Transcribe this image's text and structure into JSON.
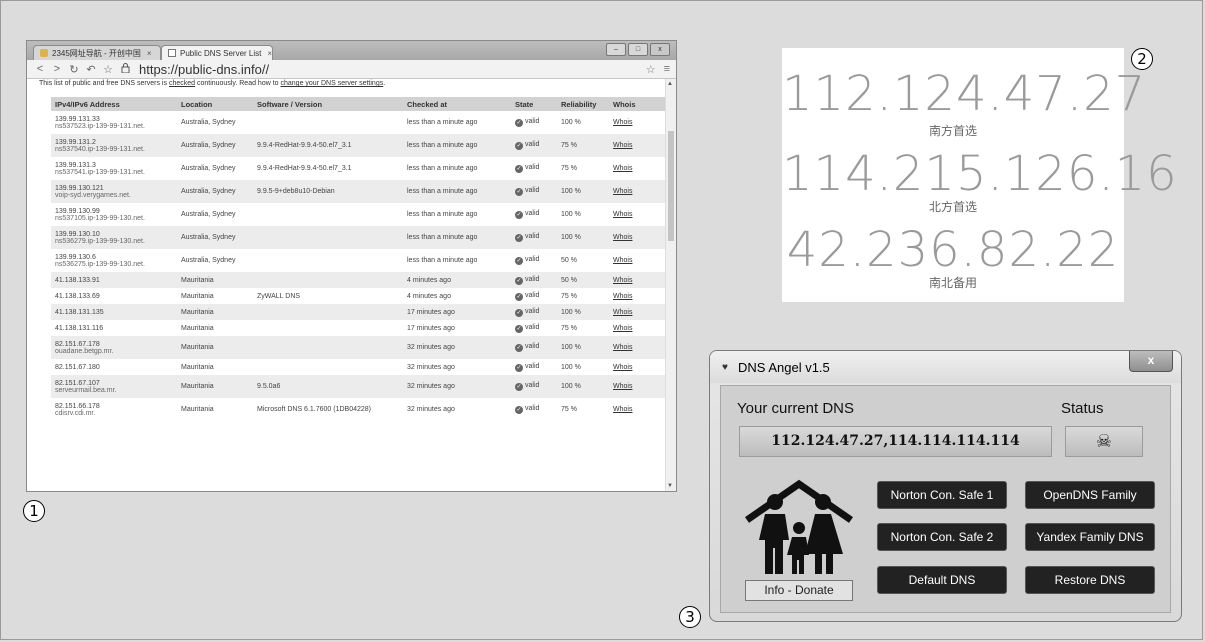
{
  "labels": {
    "one": "1",
    "two": "2",
    "three": "3"
  },
  "browser": {
    "tabs": [
      {
        "label": "2345网址导航 - 开创中国",
        "close": "×"
      },
      {
        "label": "Public DNS Server List",
        "close": "×"
      }
    ],
    "window_buttons": {
      "minimize": "–",
      "maximize": "□",
      "close": "x"
    },
    "nav": {
      "back": "<",
      "forward": ">",
      "reload": "↻",
      "undo": "↶",
      "bookmark": "☆"
    },
    "url": "https://public-dns.info//",
    "addr_right": {
      "star": "☆",
      "menu": "≡"
    },
    "intro": {
      "before": "This list of public and free DNS servers is ",
      "checked": "checked",
      "middle": " continuously. Read how to ",
      "link": "change your DNS server settings",
      "after": "."
    },
    "table": {
      "headers": [
        "IPv4/IPv6 Address",
        "Location",
        "Software / Version",
        "Checked at",
        "State",
        "Reliability",
        "Whois"
      ],
      "rows": [
        {
          "ip": "139.99.131.33",
          "host": "ns537523.ip-139-99-131.net.",
          "location": "Australia, Sydney",
          "software": "",
          "checked": "less than a minute ago",
          "state": "valid",
          "reliability": "100 %",
          "whois": "Whois"
        },
        {
          "ip": "139.99.131.2",
          "host": "ns537540.ip-139-99-131.net.",
          "location": "Australia, Sydney",
          "software": "9.9.4-RedHat-9.9.4-50.el7_3.1",
          "checked": "less than a minute ago",
          "state": "valid",
          "reliability": "75 %",
          "whois": "Whois"
        },
        {
          "ip": "139.99.131.3",
          "host": "ns537541.ip-139-99-131.net.",
          "location": "Australia, Sydney",
          "software": "9.9.4-RedHat-9.9.4-50.el7_3.1",
          "checked": "less than a minute ago",
          "state": "valid",
          "reliability": "75 %",
          "whois": "Whois"
        },
        {
          "ip": "139.99.130.121",
          "host": "voip-syd.verygames.net.",
          "location": "Australia, Sydney",
          "software": "9.9.5-9+deb8u10-Debian",
          "checked": "less than a minute ago",
          "state": "valid",
          "reliability": "100 %",
          "whois": "Whois"
        },
        {
          "ip": "139.99.130.99",
          "host": "ns537105.ip-139-99-130.net.",
          "location": "Australia, Sydney",
          "software": "",
          "checked": "less than a minute ago",
          "state": "valid",
          "reliability": "100 %",
          "whois": "Whois"
        },
        {
          "ip": "139.99.130.10",
          "host": "ns536279.ip-139-99-130.net.",
          "location": "Australia, Sydney",
          "software": "",
          "checked": "less than a minute ago",
          "state": "valid",
          "reliability": "100 %",
          "whois": "Whois"
        },
        {
          "ip": "139.99.130.6",
          "host": "ns536275.ip-139-99-130.net.",
          "location": "Australia, Sydney",
          "software": "",
          "checked": "less than a minute ago",
          "state": "valid",
          "reliability": "50 %",
          "whois": "Whois"
        },
        {
          "ip": "41.138.133.91",
          "host": "",
          "location": "Mauritania",
          "software": "",
          "checked": "4 minutes ago",
          "state": "valid",
          "reliability": "50 %",
          "whois": "Whois"
        },
        {
          "ip": "41.138.133.69",
          "host": "",
          "location": "Mauritania",
          "software": "ZyWALL DNS",
          "checked": "4 minutes ago",
          "state": "valid",
          "reliability": "75 %",
          "whois": "Whois"
        },
        {
          "ip": "41.138.131.135",
          "host": "",
          "location": "Mauritania",
          "software": "",
          "checked": "17 minutes ago",
          "state": "valid",
          "reliability": "100 %",
          "whois": "Whois"
        },
        {
          "ip": "41.138.131.116",
          "host": "",
          "location": "Mauritania",
          "software": "",
          "checked": "17 minutes ago",
          "state": "valid",
          "reliability": "75 %",
          "whois": "Whois"
        },
        {
          "ip": "82.151.67.178",
          "host": "ouadane.betgp.mr.",
          "location": "Mauritania",
          "software": "",
          "checked": "32 minutes ago",
          "state": "valid",
          "reliability": "100 %",
          "whois": "Whois"
        },
        {
          "ip": "82.151.67.180",
          "host": "",
          "location": "Mauritania",
          "software": "",
          "checked": "32 minutes ago",
          "state": "valid",
          "reliability": "100 %",
          "whois": "Whois"
        },
        {
          "ip": "82.151.67.107",
          "host": "serveurmail.bea.mr.",
          "location": "Mauritania",
          "software": "9.5.0a6",
          "checked": "32 minutes ago",
          "state": "valid",
          "reliability": "100 %",
          "whois": "Whois"
        },
        {
          "ip": "82.151.66.178",
          "host": "cdisrv.cdi.mr.",
          "location": "Mauritania",
          "software": "Microsoft DNS 6.1.7600 (1DB04228)",
          "checked": "32 minutes ago",
          "state": "valid",
          "reliability": "75 %",
          "whois": "Whois"
        }
      ]
    }
  },
  "dns_card": {
    "entries": [
      {
        "ip": "112.124.47.27",
        "label": "南方首选"
      },
      {
        "ip": "114.215.126.16",
        "label": "北方首选"
      },
      {
        "ip": "42.236.82.22",
        "label": "南北备用"
      }
    ]
  },
  "angel": {
    "title": "DNS Angel v1.5",
    "close": "x",
    "current_label": "Your current DNS",
    "status_label": "Status",
    "current_dns": "112.124.47.27,114.114.114.114",
    "status_icon": "☠",
    "info_donate": "Info - Donate",
    "buttons": {
      "norton1": "Norton Con. Safe 1",
      "opendns": "OpenDNS Family",
      "norton2": "Norton Con. Safe 2",
      "yandex": "Yandex Family DNS",
      "default": "Default DNS",
      "restore": "Restore DNS"
    }
  }
}
